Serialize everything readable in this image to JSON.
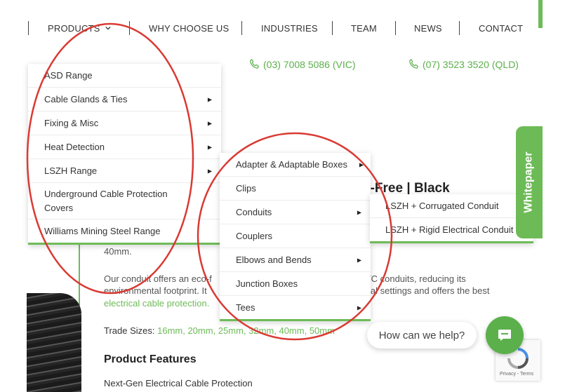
{
  "nav": {
    "items": [
      {
        "label": "PRODUCTS"
      },
      {
        "label": "WHY CHOOSE US"
      },
      {
        "label": "INDUSTRIES"
      },
      {
        "label": "TEAM"
      },
      {
        "label": "NEWS"
      },
      {
        "label": "CONTACT"
      }
    ]
  },
  "phones": {
    "vic": "(03) 7008 5086 (VIC)",
    "qld": "(07) 3523 3520 (QLD)"
  },
  "menus": {
    "products": [
      {
        "label": "ASD Range",
        "has_sub": false
      },
      {
        "label": "Cable Glands & Ties",
        "has_sub": true
      },
      {
        "label": "Fixing & Misc",
        "has_sub": true
      },
      {
        "label": "Heat Detection",
        "has_sub": true
      },
      {
        "label": "LSZH Range",
        "has_sub": true
      },
      {
        "label": "Underground Cable Protection Covers",
        "has_sub": false
      },
      {
        "label": "Williams Mining Steel Range",
        "has_sub": false
      }
    ],
    "lszh": [
      {
        "label": "Adapter & Adaptable Boxes",
        "has_sub": true
      },
      {
        "label": "Clips",
        "has_sub": false
      },
      {
        "label": "Conduits",
        "has_sub": true
      },
      {
        "label": "Couplers",
        "has_sub": false
      },
      {
        "label": "Elbows and Bends",
        "has_sub": true
      },
      {
        "label": "Junction Boxes",
        "has_sub": false
      },
      {
        "label": "Tees",
        "has_sub": true
      }
    ],
    "conduits": [
      {
        "label": "LSZH + Corrugated Conduit"
      },
      {
        "label": "LSZH + Rigid Electrical Conduit"
      }
    ]
  },
  "content": {
    "title_fragment": "n-Free | Black",
    "size_fragment": "40mm.",
    "para_line1_left": "Our conduit offers an eco-f",
    "para_line1_right": "/C conduits, reducing its",
    "para_line2_left": "environmental footprint. It",
    "para_line2_right": "ial settings and offers the best",
    "para_link": "electrical cable protection.",
    "trade_label": "Trade Sizes: ",
    "trade_sizes": "16mm, 20mm, 25mm, 32mm, 40mm, 50mm",
    "features_heading": "Product Features",
    "feature_1": "Next-Gen Electrical Cable Protection"
  },
  "whitepaper_label": "Whitepaper",
  "chat": {
    "prompt": "How can we help?"
  },
  "recaptcha_text": "Privacy - Terms",
  "colors": {
    "brand_green": "#6dbb57",
    "annotation_red": "#d93a33"
  },
  "icons": [
    "chevron-down-icon",
    "phone-icon",
    "submenu-arrow-icon",
    "chat-icon",
    "recaptcha-icon"
  ]
}
